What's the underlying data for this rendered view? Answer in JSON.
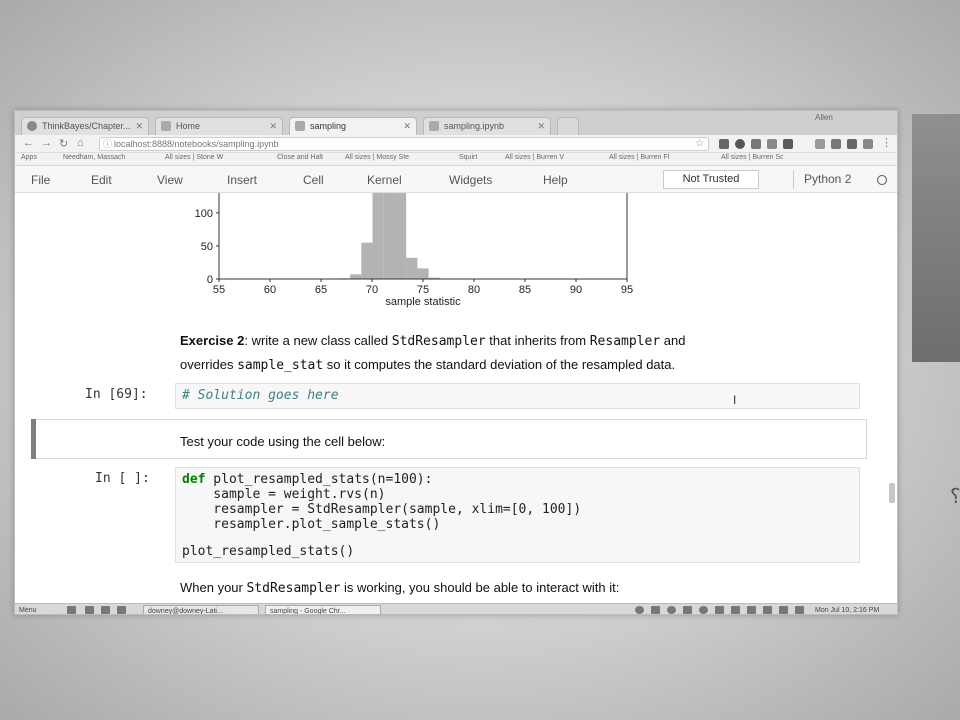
{
  "browser": {
    "tabs": [
      {
        "label": "ThinkBayes/Chapter...",
        "active": false
      },
      {
        "label": "Home",
        "active": false
      },
      {
        "label": "sampling",
        "active": true
      },
      {
        "label": "sampling.ipynb",
        "active": false
      }
    ],
    "user_label": "Allen",
    "url": "localhost:8888/notebooks/sampling.ipynb",
    "bookmarks": [
      "Apps",
      "Needham, Massach",
      "All sizes | Stone W",
      "Close and Halt",
      "All sizes | Mossy Ste",
      "Squirt",
      "All sizes | Burren V",
      "All sizes | Burren Fl",
      "All sizes | Burren Sc"
    ]
  },
  "menubar": {
    "items": [
      "File",
      "Edit",
      "View",
      "Insert",
      "Cell",
      "Kernel",
      "Widgets",
      "Help"
    ],
    "trust": "Not Trusted",
    "kernel": "Python 2"
  },
  "chart_data": {
    "type": "bar",
    "title": "",
    "xlabel": "sample statistic",
    "ylabel": "",
    "xlim": [
      55,
      95
    ],
    "ylim": [
      0,
      130
    ],
    "x_ticks": [
      "55",
      "60",
      "65",
      "70",
      "75",
      "80",
      "85",
      "90",
      "95"
    ],
    "y_ticks": [
      "0",
      "50",
      "100"
    ],
    "bin_width": 1.1,
    "bins": [
      {
        "x": 67.3,
        "count": 1
      },
      {
        "x": 68.4,
        "count": 7
      },
      {
        "x": 69.5,
        "count": 55
      },
      {
        "x": 70.6,
        "count": 130
      },
      {
        "x": 71.7,
        "count": 130
      },
      {
        "x": 72.8,
        "count": 130
      },
      {
        "x": 73.9,
        "count": 32
      },
      {
        "x": 75.0,
        "count": 16
      },
      {
        "x": 76.1,
        "count": 2
      }
    ],
    "bar_color": "#b3b3b3"
  },
  "cells": {
    "exercise": {
      "title": "Exercise 2",
      "t1": ": write a new class called ",
      "c1": "StdResampler",
      "t2": " that inherits from ",
      "c2": "Resampler",
      "t3": " and",
      "t4": "overrides ",
      "c3": "sample_stat",
      "t5": " so it computes the standard deviation of the resampled data."
    },
    "solution": {
      "prompt": "In [69]:",
      "code": "# Solution goes here"
    },
    "test_md": "Test your code using the cell below:",
    "plot_cell": {
      "prompt": "In [ ]:",
      "def_kw": "def",
      "line1_rest": " plot_resampled_stats(n=100):",
      "line2": "    sample = weight.rvs(n)",
      "line3": "    resampler = StdResampler(sample, xlim=[0, 100])",
      "line4": "    resampler.plot_sample_stats()",
      "line6": "plot_resampled_stats()"
    },
    "interact_md": {
      "t1": "When your ",
      "c1": "StdResampler",
      "t2": " is working, you should be able to interact with it:"
    }
  },
  "taskbar": {
    "menu": "Menu",
    "tasks": [
      "downey@downey-Lati...",
      "sampling - Google Chr..."
    ],
    "clock": "Mon Jul 10,  2:16 PM"
  }
}
